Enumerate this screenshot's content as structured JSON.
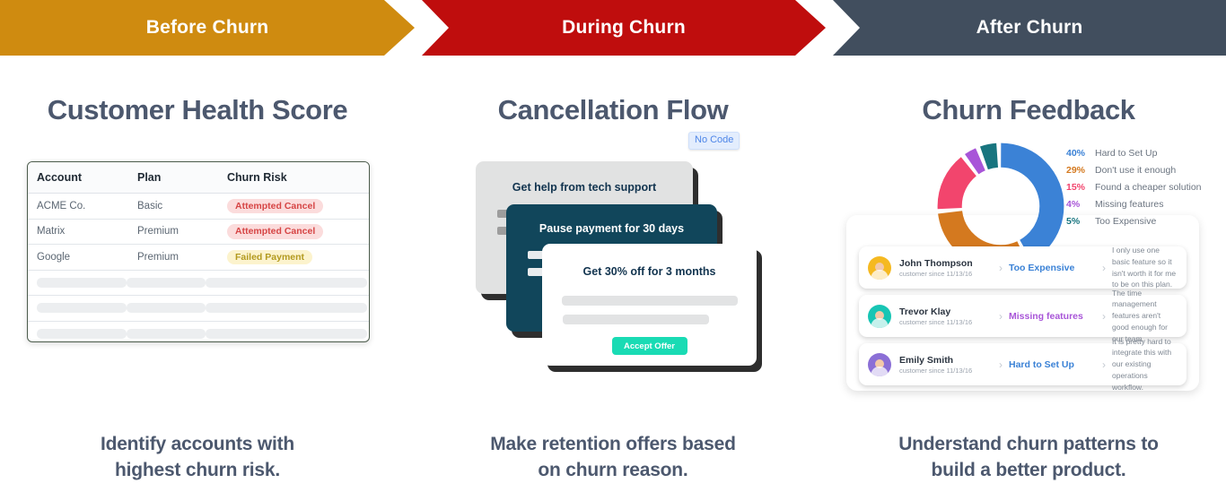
{
  "stages": [
    {
      "label": "Before Churn",
      "color": "#cf8b10"
    },
    {
      "label": "During Churn",
      "color": "#bf0d0d"
    },
    {
      "label": "After Churn",
      "color": "#414e5e"
    }
  ],
  "columns": [
    {
      "heading": "Customer Health Score",
      "caption_line1": "Identify accounts with",
      "caption_line2": "highest churn risk."
    },
    {
      "heading": "Cancellation Flow",
      "caption_line1": "Make retention offers based",
      "caption_line2": "on churn reason."
    },
    {
      "heading": "Churn Feedback",
      "caption_line1": "Understand churn patterns to",
      "caption_line2": "build a better product."
    }
  ],
  "table": {
    "headers": [
      "Account",
      "Plan",
      "Churn Risk"
    ],
    "rows": [
      {
        "account": "ACME Co.",
        "plan": "Basic",
        "risk": "Attempted Cancel",
        "risk_type": "red"
      },
      {
        "account": "Matrix",
        "plan": "Premium",
        "risk": "Attempted Cancel",
        "risk_type": "red"
      },
      {
        "account": "Google",
        "plan": "Premium",
        "risk": "Failed Payment",
        "risk_type": "yellow"
      }
    ],
    "placeholder_rows": 3,
    "badge_colors": {
      "red_bg": "#fbdcdc",
      "red_text": "#d64545",
      "yellow_bg": "#fcf3cd",
      "yellow_text": "#b39a1f"
    }
  },
  "flow": {
    "badge": "No Code",
    "badge_color": "#4e86e8",
    "cards": [
      {
        "title": "Get help from tech support"
      },
      {
        "title": "Pause payment for 30 days"
      },
      {
        "title": "Get 30% off for 3 months"
      }
    ],
    "accept_label": "Accept Offer",
    "accept_color": "#19dbb4"
  },
  "chart_data": {
    "type": "pie",
    "title": "Churn Feedback",
    "categories": [
      "Hard to Set Up",
      "Don't use it enough",
      "Found a cheaper solution",
      "Missing features",
      "Too Expensive"
    ],
    "values": [
      40,
      29,
      15,
      4,
      5
    ],
    "value_labels": [
      "40%",
      "29%",
      "15%",
      "4%",
      "5%"
    ],
    "colors": [
      "#3b82d6",
      "#d4791f",
      "#f2456d",
      "#a855d8",
      "#18757f"
    ],
    "legend": "right",
    "donut": true
  },
  "feedback": [
    {
      "name": "John Thompson",
      "since": "customer since 11/13/16",
      "reason": "Too Expensive",
      "reason_color": "#3b82d6",
      "avatar_color": "#f5b921",
      "quote": "I only use one basic feature so it isn't worth it for me to be on this plan."
    },
    {
      "name": "Trevor Klay",
      "since": "customer since 11/13/16",
      "reason": "Missing features",
      "reason_color": "#a855d8",
      "avatar_color": "#18c5b4",
      "quote": "The time management features aren't good enough for our team."
    },
    {
      "name": "Emily Smith",
      "since": "customer since 11/13/16",
      "reason": "Hard to Set Up",
      "reason_color": "#3b82d6",
      "avatar_color": "#8b6fd6",
      "quote": "It is pretty hard to integrate this with our existing operations workflow."
    }
  ],
  "icons": {
    "chevron": "›"
  }
}
